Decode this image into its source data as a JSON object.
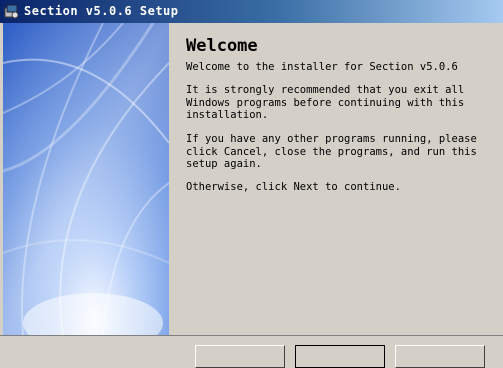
{
  "window": {
    "title": "Section v5.0.6 Setup"
  },
  "welcome": {
    "heading": "Welcome",
    "paragraphs": [
      "Welcome to the installer for Section v5.0.6",
      "It is strongly recommended that you exit all\nWindows programs before continuing with this\ninstallation.",
      "If you have any other programs running, please\nclick Cancel, close the programs, and run this\nsetup again.",
      "Otherwise, click Next to continue."
    ]
  },
  "colors": {
    "titlebar_start": "#0a246a",
    "titlebar_end": "#a6caf0",
    "banner_light": "#cfe0ff",
    "banner_dark": "#2f62c8",
    "dialog_face": "#d4d0c8"
  },
  "icons": {
    "title": "installer-app-icon"
  }
}
